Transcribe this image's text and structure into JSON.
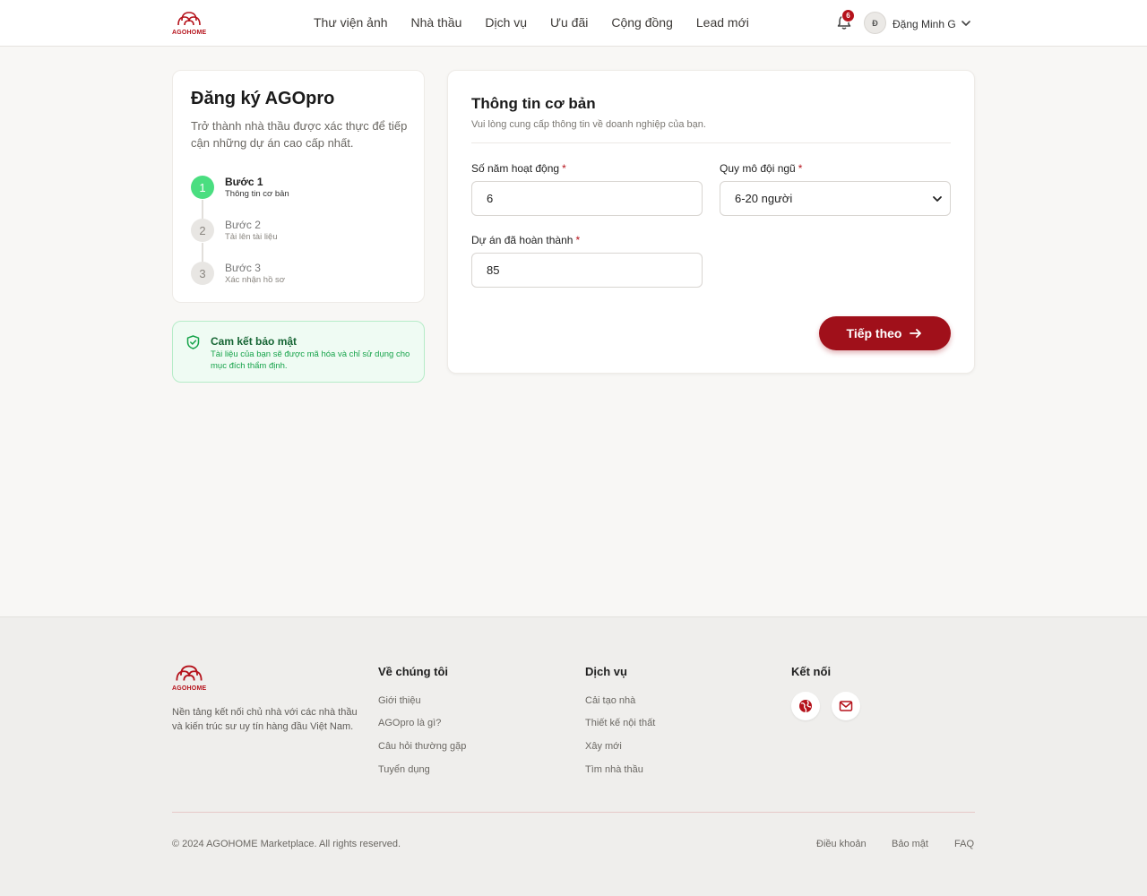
{
  "brand": {
    "logo_text": "AGOHOME",
    "accent": "#a0101a",
    "success": "#4ade80"
  },
  "header": {
    "nav": [
      "Thư viện ảnh",
      "Nhà thầu",
      "Dịch vụ",
      "Ưu đãi",
      "Cộng đồng",
      "Lead mới"
    ],
    "notification_count": "6",
    "avatar_initial": "Đ",
    "user_name": "Đặng Minh G"
  },
  "steps_card": {
    "title": "Đăng ký AGOpro",
    "description": "Trở thành nhà thầu được xác thực để tiếp cận những dự án cao cấp nhất.",
    "steps": [
      {
        "number": "1",
        "label": "Bước 1",
        "sub": "Thông tin cơ bản",
        "active": true
      },
      {
        "number": "2",
        "label": "Bước 2",
        "sub": "Tải lên tài liệu",
        "active": false
      },
      {
        "number": "3",
        "label": "Bước 3",
        "sub": "Xác nhận hồ sơ",
        "active": false
      }
    ]
  },
  "security": {
    "title": "Cam kết bảo mật",
    "text": "Tài liệu của bạn sẽ được mã hóa và chỉ sử dụng cho mục đích thẩm định."
  },
  "form": {
    "title": "Thông tin cơ bản",
    "description": "Vui lòng cung cấp thông tin về doanh nghiệp của bạn.",
    "years_label": "Số năm hoạt động",
    "years_value": "6",
    "team_label": "Quy mô đội ngũ",
    "team_value": "6-20 người",
    "projects_label": "Dự án đã hoàn thành",
    "projects_value": "85",
    "required_mark": "*",
    "next_label": "Tiếp theo"
  },
  "footer": {
    "about": "Nền tảng kết nối chủ nhà với các nhà thầu và kiến trúc sư uy tín hàng đầu Việt Nam.",
    "col_about_title": "Về chúng tôi",
    "col_about_links": [
      "Giới thiệu",
      "AGOpro là gì?",
      "Câu hỏi thường gặp",
      "Tuyển dụng"
    ],
    "col_services_title": "Dịch vụ",
    "col_services_links": [
      "Cải tạo nhà",
      "Thiết kế nội thất",
      "Xây mới",
      "Tìm nhà thầu"
    ],
    "col_connect_title": "Kết nối",
    "copyright": "© 2024 AGOHOME Marketplace. All rights reserved.",
    "legal": [
      "Điều khoản",
      "Bảo mật",
      "FAQ"
    ]
  }
}
